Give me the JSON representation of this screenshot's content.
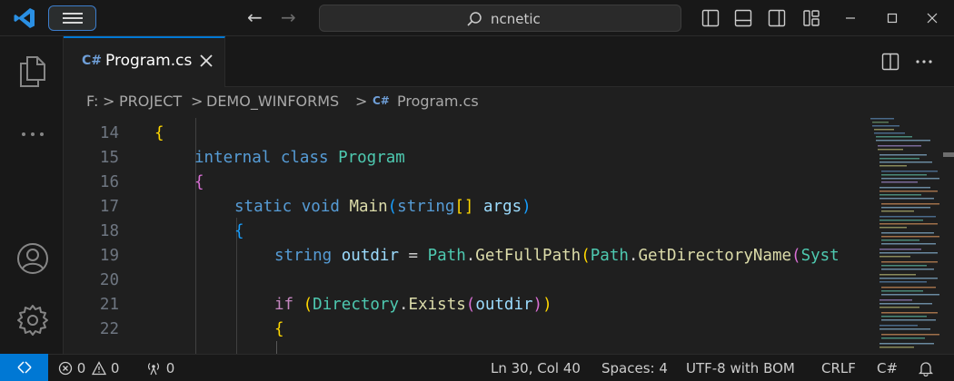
{
  "titlebar": {
    "search_text": "ncnetic"
  },
  "tab": {
    "label": "Program.cs",
    "glyph": "C#"
  },
  "breadcrumb": {
    "drive": "F:",
    "project": "PROJECT",
    "folder": "DEMO_WINFORMS",
    "file": "Program.cs",
    "separator": ">"
  },
  "editor": {
    "lines": [
      {
        "num": "14",
        "text": "{"
      },
      {
        "num": "15",
        "text": "internal class Program"
      },
      {
        "num": "16",
        "text": "{"
      },
      {
        "num": "17",
        "text": "static void Main(string[] args)"
      },
      {
        "num": "18",
        "text": "{"
      },
      {
        "num": "19",
        "text": "string outdir = Path.GetFullPath(Path.GetDirectoryName(Syst"
      },
      {
        "num": "20",
        "text": ""
      },
      {
        "num": "21",
        "text": "if (Directory.Exists(outdir))"
      },
      {
        "num": "22",
        "text": "{"
      }
    ]
  },
  "statusbar": {
    "errors": "0",
    "warnings": "0",
    "ports": "0",
    "position": "Ln 30, Col 40",
    "spaces": "Spaces: 4",
    "encoding": "UTF-8 with BOM",
    "eol": "CRLF",
    "language": "C#"
  },
  "colors": {
    "accent": "#0078d4",
    "background": "#1f1f1f",
    "keyword": "#569cd6",
    "type": "#4ec9b0",
    "function": "#dcdcaa",
    "variable": "#9cdcfe"
  }
}
